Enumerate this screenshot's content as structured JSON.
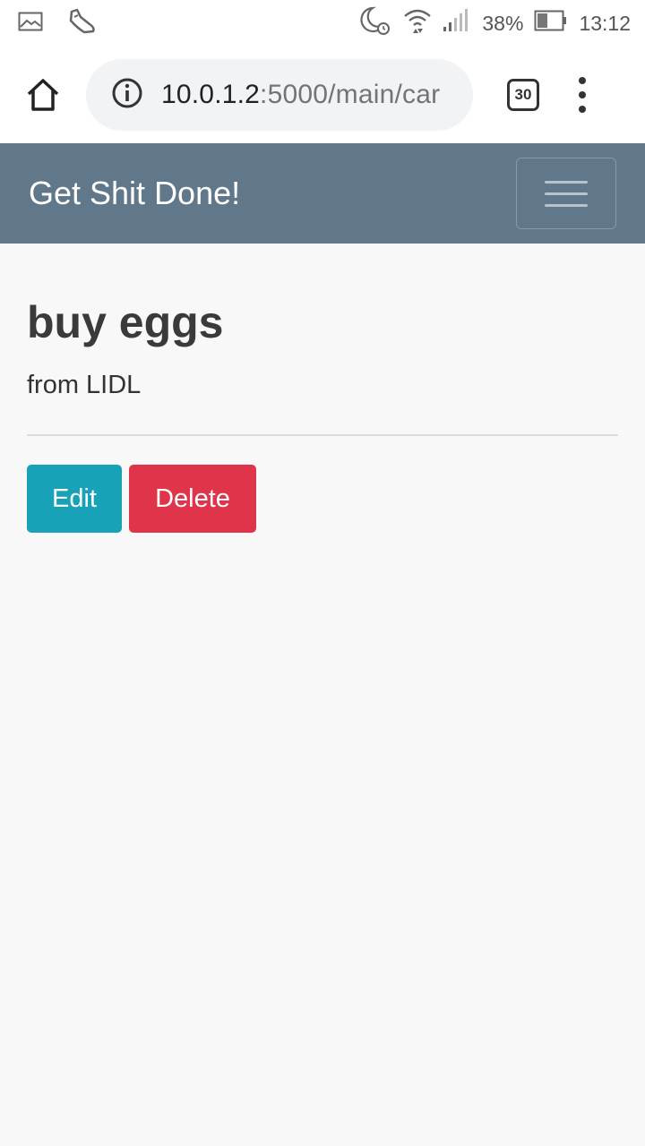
{
  "status_bar": {
    "battery_percent": "38%",
    "time": "13:12",
    "icons": [
      "image-icon",
      "shoe-icon",
      "moon-alarm-icon",
      "wifi-icon",
      "signal-icon",
      "battery-icon"
    ]
  },
  "browser": {
    "url_host": "10.0.1.2",
    "url_rest": ":5000/main/car",
    "tab_count": "30",
    "icons": [
      "home-icon",
      "info-icon",
      "more-vert-icon"
    ]
  },
  "navbar": {
    "brand": "Get Shit Done!",
    "toggler_icon": "hamburger-icon",
    "background": "#607889"
  },
  "task": {
    "title": "buy eggs",
    "description": "from LIDL"
  },
  "actions": {
    "edit_label": "Edit",
    "delete_label": "Delete",
    "edit_color": "#17a2b8",
    "delete_color": "#e0344a"
  }
}
